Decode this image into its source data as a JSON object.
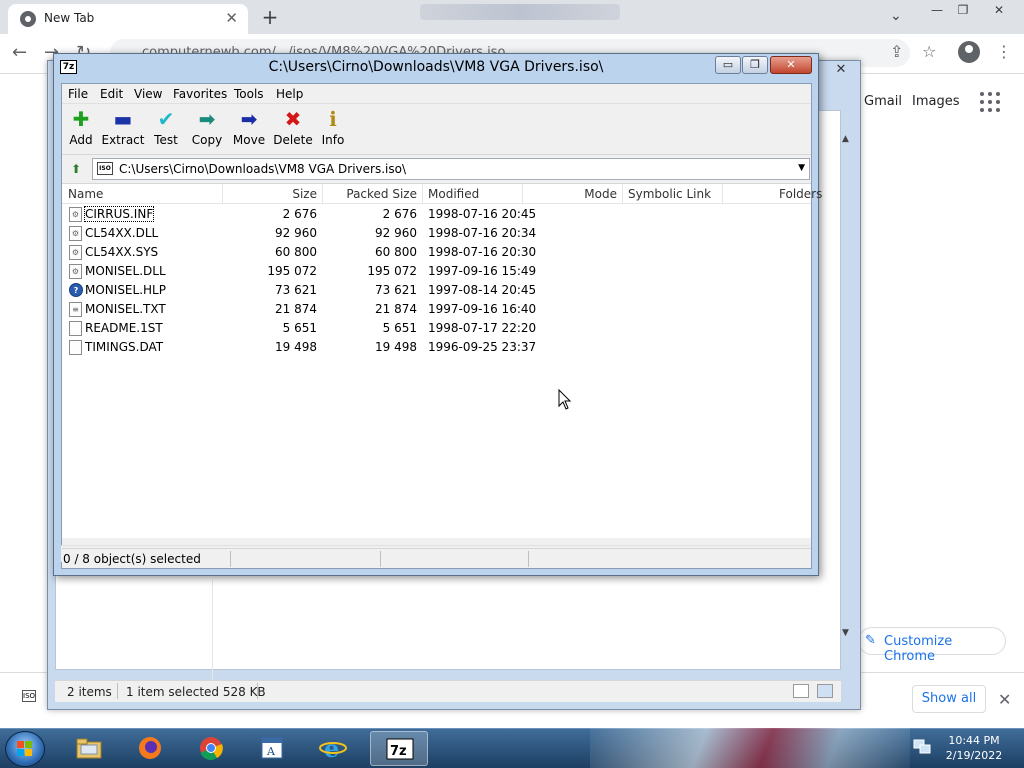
{
  "chrome": {
    "tab_title": "New Tab",
    "tab_close": "✕",
    "new_tab": "+",
    "url_fragment": "computernewb.com/.../isos/VM8%20VGA%20Drivers.iso",
    "ntp_links": {
      "gmail": "Gmail",
      "images": "Images"
    },
    "customize_label": "Customize Chrome",
    "show_all_label": "Show all",
    "close_glyph": "✕",
    "window_buttons": [
      "—",
      "❐",
      "✕"
    ]
  },
  "explorer_back": {
    "status_items": "2 items",
    "status_selected": "1 item selected  528 KB",
    "close_glyph": "✕"
  },
  "sevenzip": {
    "title": "C:\\Users\\Cirno\\Downloads\\VM8 VGA Drivers.iso\\",
    "app_icon_text": "7z",
    "window_buttons": {
      "minimize": "▭",
      "maximize": "❐",
      "close": "✕"
    },
    "menu": [
      "File",
      "Edit",
      "View",
      "Favorites",
      "Tools",
      "Help"
    ],
    "toolbar": [
      {
        "label": "Add",
        "icon": "plus-icon",
        "glyph": "✚",
        "color": "#1ea01e"
      },
      {
        "label": "Extract",
        "icon": "minus-icon",
        "glyph": "▬",
        "color": "#1b33a8"
      },
      {
        "label": "Test",
        "icon": "check-icon",
        "glyph": "✔",
        "color": "#22b8c9"
      },
      {
        "label": "Copy",
        "icon": "copy-arrow-icon",
        "glyph": "➡",
        "color": "#1a8a7a"
      },
      {
        "label": "Move",
        "icon": "move-arrow-icon",
        "glyph": "➡",
        "color": "#1a2fa6"
      },
      {
        "label": "Delete",
        "icon": "delete-x-icon",
        "glyph": "✖",
        "color": "#d41818"
      },
      {
        "label": "Info",
        "icon": "info-icon",
        "glyph": "ℹ",
        "color": "#b08a10"
      }
    ],
    "address": "C:\\Users\\Cirno\\Downloads\\VM8 VGA Drivers.iso\\",
    "address_icon_text": "ISO",
    "columns": [
      "Name",
      "Size",
      "Packed Size",
      "Modified",
      "Mode",
      "Symbolic Link",
      "Folders"
    ],
    "files": [
      {
        "name": "CIRRUS.INF",
        "size": "2 676",
        "packed": "2 676",
        "modified": "1998-07-16 20:45",
        "icon": "settings-file-icon",
        "focused": true
      },
      {
        "name": "CL54XX.DLL",
        "size": "92 960",
        "packed": "92 960",
        "modified": "1998-07-16 20:34",
        "icon": "dll-file-icon"
      },
      {
        "name": "CL54XX.SYS",
        "size": "60 800",
        "packed": "60 800",
        "modified": "1998-07-16 20:30",
        "icon": "sys-file-icon"
      },
      {
        "name": "MONISEL.DLL",
        "size": "195 072",
        "packed": "195 072",
        "modified": "1997-09-16 15:49",
        "icon": "dll-file-icon"
      },
      {
        "name": "MONISEL.HLP",
        "size": "73 621",
        "packed": "73 621",
        "modified": "1997-08-14 20:45",
        "icon": "help-file-icon"
      },
      {
        "name": "MONISEL.TXT",
        "size": "21 874",
        "packed": "21 874",
        "modified": "1997-09-16 16:40",
        "icon": "text-file-icon"
      },
      {
        "name": "README.1ST",
        "size": "5 651",
        "packed": "5 651",
        "modified": "1998-07-17 22:20",
        "icon": "blank-file-icon"
      },
      {
        "name": "TIMINGS.DAT",
        "size": "19 498",
        "packed": "19 498",
        "modified": "1996-09-25 23:37",
        "icon": "blank-file-icon"
      }
    ],
    "status": "0 / 8 object(s) selected",
    "scroll_arrows": {
      "left": "◀",
      "right": "▶",
      "grip": "|||"
    },
    "dropdown_glyph": "▼",
    "up_glyph": "⬆"
  },
  "taskbar": {
    "apps": [
      {
        "name": "file-explorer",
        "active": false
      },
      {
        "name": "firefox",
        "active": false
      },
      {
        "name": "chrome",
        "active": false
      },
      {
        "name": "wordpad",
        "active": false
      },
      {
        "name": "internet-explorer",
        "active": false
      },
      {
        "name": "7-zip",
        "active": true,
        "text": "7z"
      }
    ],
    "clock_time": "10:44 PM",
    "clock_date": "2/19/2022"
  }
}
